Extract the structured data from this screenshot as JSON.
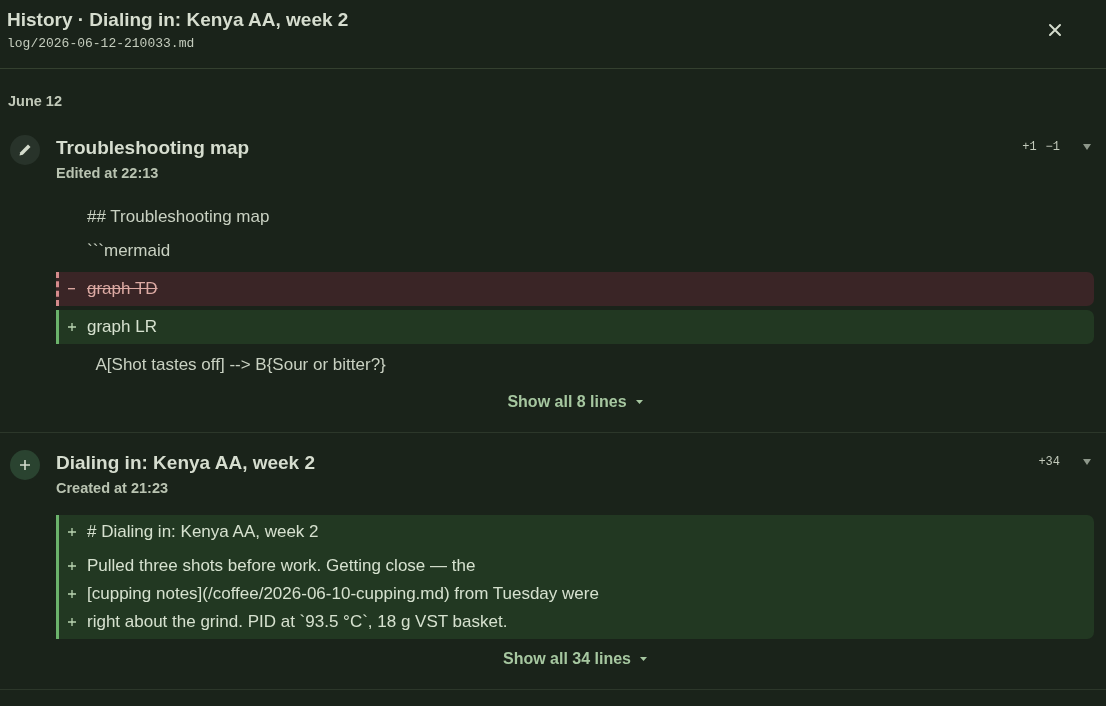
{
  "header": {
    "title": "History · Dialing in: Kenya AA, week 2",
    "path": "log/2026-06-12-210033.md"
  },
  "groups": [
    {
      "date": "June 12",
      "entries": [
        {
          "kind": "edited",
          "title": "Troubleshooting map",
          "subtitle": "Edited at 22:13",
          "stats": [
            "+1",
            "−1"
          ],
          "hunks": [
            {
              "kind": "context",
              "paragraphs": [
                [
                  "## Troubleshooting map"
                ],
                [
                  "```mermaid"
                ]
              ]
            },
            {
              "kind": "removed",
              "paragraphs": [
                [
                  "graph TD"
                ]
              ]
            },
            {
              "kind": "added",
              "paragraphs": [
                [
                  "graph LR"
                ]
              ]
            },
            {
              "kind": "context",
              "paragraphs": [
                [
                  "  A[Shot tastes off] --> B{Sour or bitter?}"
                ]
              ]
            }
          ],
          "show_all": "Show all 8 lines"
        },
        {
          "kind": "created",
          "title": "Dialing in: Kenya AA, week 2",
          "subtitle": "Created at 21:23",
          "stats": [
            "+34"
          ],
          "hunks": [
            {
              "kind": "added",
              "paragraphs": [
                [
                  "# Dialing in: Kenya AA, week 2"
                ],
                [
                  "Pulled three shots before work. Getting close — the",
                  "[cupping notes](/coffee/2026-06-10-cupping.md) from Tuesday were",
                  "right about the grind. PID at `93.5 °C`, 18 g VST basket."
                ]
              ]
            }
          ],
          "show_all": "Show all 34 lines"
        }
      ]
    }
  ]
}
